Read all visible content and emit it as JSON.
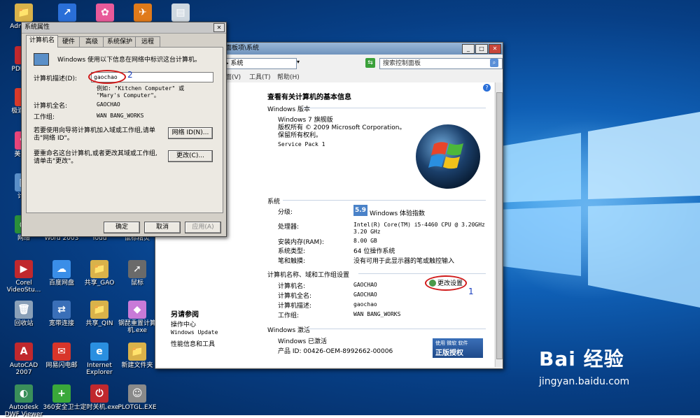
{
  "desktop": {
    "icons": [
      {
        "name": "admin-folder-icon",
        "label": "Administ",
        "glyph": "📁",
        "color": "#d9b24a"
      },
      {
        "name": "shortcut-icon-1",
        "label": "",
        "glyph": "↗",
        "color": "#2a6fd8"
      },
      {
        "name": "shortcut-icon-2",
        "label": "",
        "glyph": "✿",
        "color": "#e85a9a"
      },
      {
        "name": "shortcut-icon-3",
        "label": "",
        "glyph": "✈",
        "color": "#e07a1a"
      },
      {
        "name": "document-icon",
        "label": "",
        "glyph": "▤",
        "color": "#cfd8e0"
      },
      {
        "name": "pdfedit-icon",
        "label": "PDFEdit",
        "glyph": "P",
        "color": "#c0282d"
      },
      {
        "name": "jisu-pdf-icon",
        "label": "极速PDF",
        "glyph": "P",
        "color": "#d83a2a"
      },
      {
        "name": "meitu-icon",
        "label": "美图秀",
        "glyph": "❀",
        "color": "#e8457a"
      },
      {
        "name": "computer-icon",
        "label": "计算",
        "glyph": "▣",
        "color": "#5a8fc8"
      },
      {
        "name": "network-icon",
        "label": "网络",
        "glyph": "◉",
        "color": "#2a8f3a"
      },
      {
        "name": "word2003-icon",
        "label": "Word 2003",
        "glyph": "W",
        "color": "#2b5fb8"
      },
      {
        "name": "youdao-icon",
        "label": "Youd",
        "glyph": "Y",
        "color": "#d8352a"
      },
      {
        "name": "mouse-wizard-icon",
        "label": "鼠标精灵",
        "glyph": "✦",
        "color": "#e07a1a"
      },
      {
        "name": "corel-icon",
        "label": "Corel VideoStu...",
        "glyph": "▶",
        "color": "#c0282d"
      },
      {
        "name": "baidu-netdisk-icon",
        "label": "百度网盘",
        "glyph": "☁",
        "color": "#3a8ee8"
      },
      {
        "name": "share-gao-icon",
        "label": "共享_GAO",
        "glyph": "📁",
        "color": "#d9b24a"
      },
      {
        "name": "mouse-icon",
        "label": "鼠标",
        "glyph": "➚",
        "color": "#6a6a6a"
      },
      {
        "name": "recycle-bin-icon",
        "label": "回收站",
        "glyph": "🗑",
        "color": "#8aa0b8"
      },
      {
        "name": "broadband-icon",
        "label": "宽带连接",
        "glyph": "⇄",
        "color": "#3a6fb8"
      },
      {
        "name": "share-qin-icon",
        "label": "共享_QIN",
        "glyph": "📁",
        "color": "#d9b24a"
      },
      {
        "name": "reset-computer-icon",
        "label": "钢琵重置计算机.exe",
        "glyph": "◆",
        "color": "#c87ad8"
      },
      {
        "name": "autocad-icon",
        "label": "AutoCAD 2007",
        "glyph": "A",
        "color": "#c0282d"
      },
      {
        "name": "wangyi-icon",
        "label": "网易闪电邮",
        "glyph": "✉",
        "color": "#d8352a"
      },
      {
        "name": "ie-icon",
        "label": "Internet Explorer",
        "glyph": "e",
        "color": "#2a8fe0"
      },
      {
        "name": "new-folder-icon",
        "label": "新建文件夹",
        "glyph": "📁",
        "color": "#d9b24a"
      },
      {
        "name": "dwf-viewer-icon",
        "label": "Autodesk DWF Viewer",
        "glyph": "◐",
        "color": "#3a8f5a"
      },
      {
        "name": "360-icon",
        "label": "360安全卫士",
        "glyph": "+",
        "color": "#3aa83a"
      },
      {
        "name": "shutdown-icon",
        "label": "定时关机.exe",
        "glyph": "⏻",
        "color": "#c0282d"
      },
      {
        "name": "plotgl-icon",
        "label": "PLOTGL.EXE",
        "glyph": "☺",
        "color": "#8a8a8a"
      }
    ],
    "watermark_text": "Bai 经验",
    "watermark_url": "jingyan.baidu.com"
  },
  "control_panel": {
    "title": "面板项\\系统",
    "breadcrumb": "面板 ▸ 所有控制面板项 ▸ 系统",
    "search_placeholder": "搜索控制面板",
    "menu": {
      "view": "面(V)",
      "tools": "工具(T)",
      "help": "帮助(H)"
    },
    "heading": "查看有关计算机的基本信息",
    "edition_section": "Windows 版本",
    "edition": "Windows 7 旗舰版",
    "copyright": "版权所有 © 2009 Microsoft Corporation。保留所有权利。",
    "service_pack": "Service Pack 1",
    "system_section": "系统",
    "rating_label": "分级:",
    "rating_score": "5.9",
    "rating_text": "Windows 体验指数",
    "processor_label": "处理器:",
    "processor_value": "Intel(R) Core(TM) i5-4460  CPU @ 3.20GHz 3.20 GHz",
    "ram_label": "安装内存(RAM):",
    "ram_value": "8.00 GB",
    "type_label": "系统类型:",
    "type_value": "64 位操作系统",
    "pen_label": "笔和触摸:",
    "pen_value": "没有可用于此显示器的笔或触控输入",
    "name_section": "计算机名称、域和工作组设置",
    "cname_label": "计算机名:",
    "cname_value": "GAOCHAO",
    "fullname_label": "计算机全名:",
    "fullname_value": "GAOCHAO",
    "desc_label": "计算机描述:",
    "desc_value": "gaochao",
    "workgroup_label": "工作组:",
    "workgroup_value": "WAN BANG_WORKS",
    "change_settings": "更改设置",
    "activation_section": "Windows 激活",
    "activated": "Windows 已激活",
    "product_id": "产品 ID: 00426-OEM-8992662-00006",
    "see_also": "另请参阅",
    "action_center": "操作中心",
    "windows_update": "Windows Update",
    "perf_info": "性能信息和工具",
    "genuine_line1": "使用 微软 软件",
    "genuine_line2": "正版授权",
    "annotation_1": "1"
  },
  "dialog": {
    "title": "系统属性",
    "tabs": [
      "计算机名",
      "硬件",
      "高级",
      "系统保护",
      "远程"
    ],
    "intro": "Windows 使用以下信息在网络中标识这台计算机。",
    "desc_label": "计算机描述(D):",
    "desc_value": "gaochao",
    "example": "例如: \"Kitchen Computer\" 或 \"Mary's Computer\"。",
    "fullname_label": "计算机全名:",
    "fullname_value": "GAOCHAO",
    "workgroup_label": "工作组:",
    "workgroup_value": "WAN BANG_WORKS",
    "wizard_text": "若要使用向导将计算机加入域或工作组,请单击\"网络 ID\"。",
    "network_id_button": "网络 ID(N)...",
    "rename_text": "要重命名这台计算机,或者更改其域或工作组,请单击\"更改\"。",
    "change_button": "更改(C)...",
    "ok_button": "确定",
    "cancel_button": "取消",
    "apply_button": "应用(A)",
    "annotation_2": "2"
  }
}
